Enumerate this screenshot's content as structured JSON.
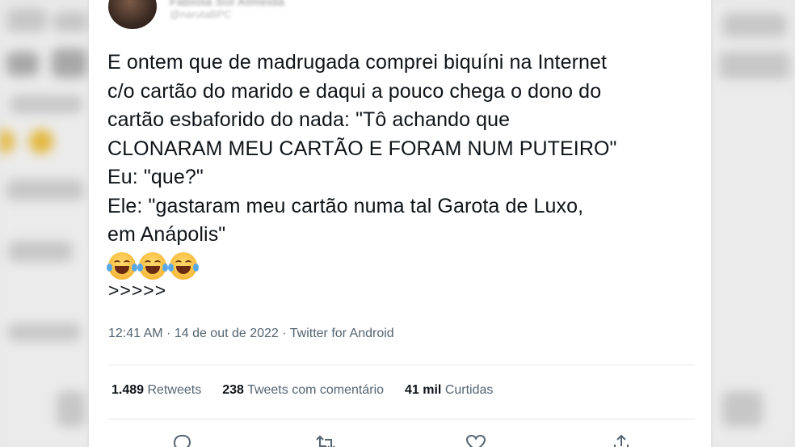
{
  "author": {
    "name": "Fabíola Sol Almeida",
    "handle": "@narutaBPC"
  },
  "tweet": {
    "text": "E ontem que de madrugada comprei biquíni na Internet\nc/o cartão do marido e daqui a pouco chega o dono do\ncartão esbaforido do nada: \"Tô achando que\nCLONARAM MEU CARTÃO E FORAM NUM PUTEIRO\"\nEu: \"que?\"\nEle: \"gastaram meu cartão numa tal Garota de Luxo,\nem Anápolis\"",
    "emojis": [
      "face-with-tears-of-joy",
      "face-with-tears-of-joy",
      "face-with-tears-of-joy"
    ],
    "continuation": ">>>>>",
    "meta": "12:41 AM · 14 de out de 2022 · Twitter for Android"
  },
  "stats": {
    "retweets_count": "1.489",
    "retweets_label": "Retweets",
    "quotes_count": "238",
    "quotes_label": "Tweets com comentário",
    "likes_count": "41 mil",
    "likes_label": "Curtidas"
  },
  "actions": [
    "reply-icon",
    "retweet-icon",
    "like-icon",
    "share-icon"
  ],
  "colors": {
    "text": "#0f1419",
    "secondary": "#536471",
    "divider": "#e3e7ea",
    "background": "#ffffff"
  }
}
